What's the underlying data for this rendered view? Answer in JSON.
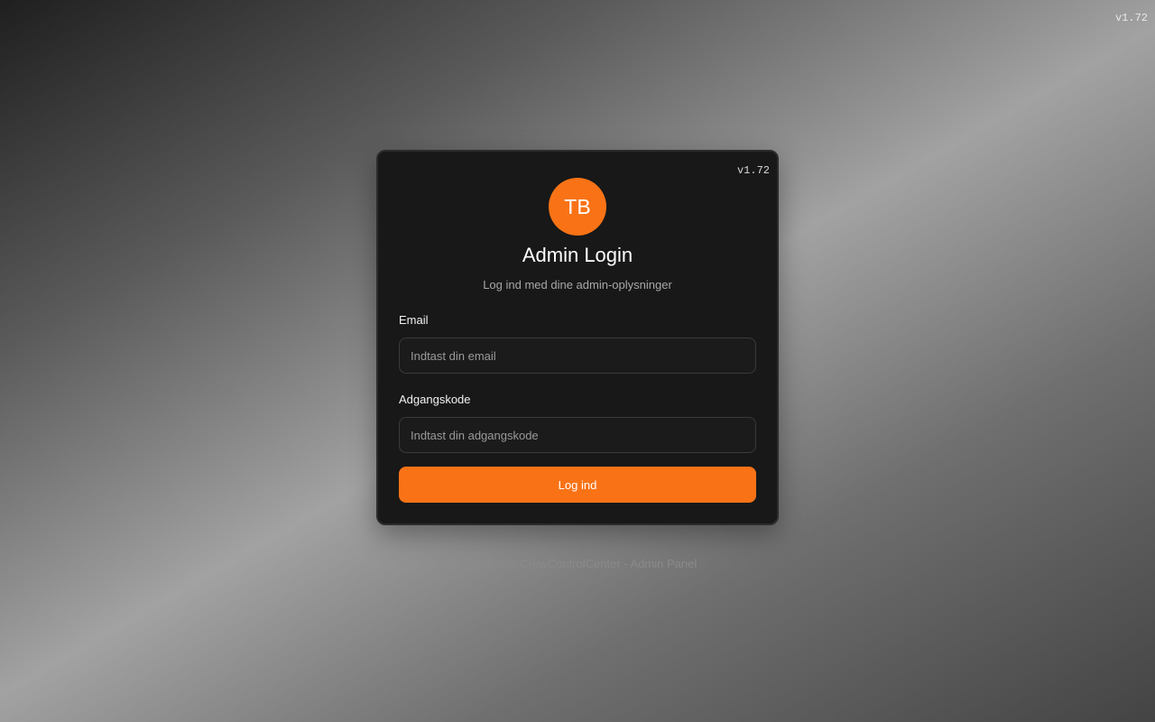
{
  "app_version": "v1.72",
  "login_card": {
    "version": "v1.72",
    "avatar_initials": "TB",
    "title": "Admin Login",
    "subtitle": "Log ind med dine admin-oplysninger",
    "email": {
      "label": "Email",
      "value": "",
      "placeholder": "Indtast din email"
    },
    "password": {
      "label": "Adgangskode",
      "value": "",
      "placeholder": "Indtast din adgangskode"
    },
    "submit_label": "Log ind"
  },
  "footer": {
    "text": "TeamBattle CrewControlCenter - Admin Panel"
  },
  "colors": {
    "accent": "#f97316",
    "card_background": "#181818"
  }
}
